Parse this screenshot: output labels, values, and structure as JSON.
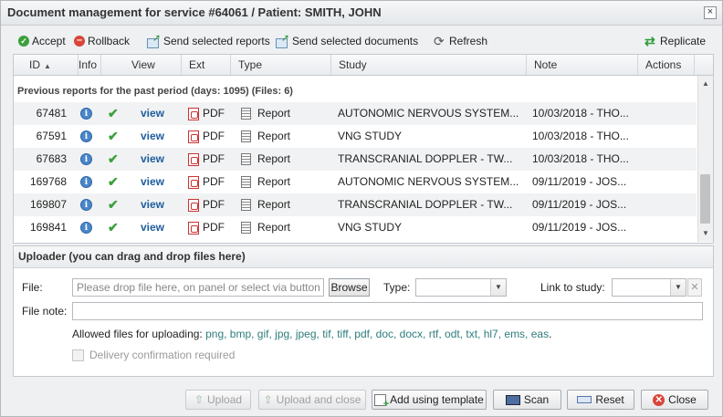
{
  "window": {
    "title": "Document management for service #64061 / Patient: SMITH, JOHN",
    "close_glyph": "×"
  },
  "toolbar": {
    "accept": "Accept",
    "rollback": "Rollback",
    "send_reports": "Send selected reports",
    "send_documents": "Send selected documents",
    "refresh": "Refresh",
    "replicate": "Replicate"
  },
  "grid": {
    "columns": [
      "ID",
      "Info",
      "View",
      "Ext",
      "Type",
      "Study",
      "Note",
      "Actions"
    ],
    "group_label": "Previous reports for the past period (days: 1095) (Files: 6)",
    "rows": [
      {
        "id": "67481",
        "view": "view",
        "ext": "PDF",
        "type": "Report",
        "study": "AUTONOMIC NERVOUS SYSTEM...",
        "note": "10/03/2018 - THO..."
      },
      {
        "id": "67591",
        "view": "view",
        "ext": "PDF",
        "type": "Report",
        "study": "VNG STUDY",
        "note": "10/03/2018 - THO..."
      },
      {
        "id": "67683",
        "view": "view",
        "ext": "PDF",
        "type": "Report",
        "study": "TRANSCRANIAL DOPPLER - TW...",
        "note": "10/03/2018 - THO..."
      },
      {
        "id": "169768",
        "view": "view",
        "ext": "PDF",
        "type": "Report",
        "study": "AUTONOMIC NERVOUS SYSTEM...",
        "note": "09/11/2019 - JOS..."
      },
      {
        "id": "169807",
        "view": "view",
        "ext": "PDF",
        "type": "Report",
        "study": "TRANSCRANIAL DOPPLER - TW...",
        "note": "09/11/2019 - JOS..."
      },
      {
        "id": "169841",
        "view": "view",
        "ext": "PDF",
        "type": "Report",
        "study": "VNG STUDY",
        "note": "09/11/2019 - JOS..."
      }
    ]
  },
  "uploader": {
    "header": "Uploader (you can drag and drop files here)",
    "file_label": "File:",
    "file_placeholder": "Please drop file here, on panel or select via button",
    "browse": "Browse",
    "type_label": "Type:",
    "type_value": "",
    "link_label": "Link to study:",
    "link_value": "",
    "note_label": "File note:",
    "note_value": "",
    "allowed_prefix": "Allowed files for uploading:",
    "allowed_exts": "png, bmp, gif, jpg, jpeg, tif, tiff, pdf, doc, docx, rtf, odt, txt, hl7, ems, eas",
    "allowed_suffix": ".",
    "delivery": "Delivery confirmation required"
  },
  "footer": {
    "upload": "Upload",
    "upload_close": "Upload and close",
    "add_template": "Add using template",
    "scan": "Scan",
    "reset": "Reset",
    "close": "Close"
  }
}
